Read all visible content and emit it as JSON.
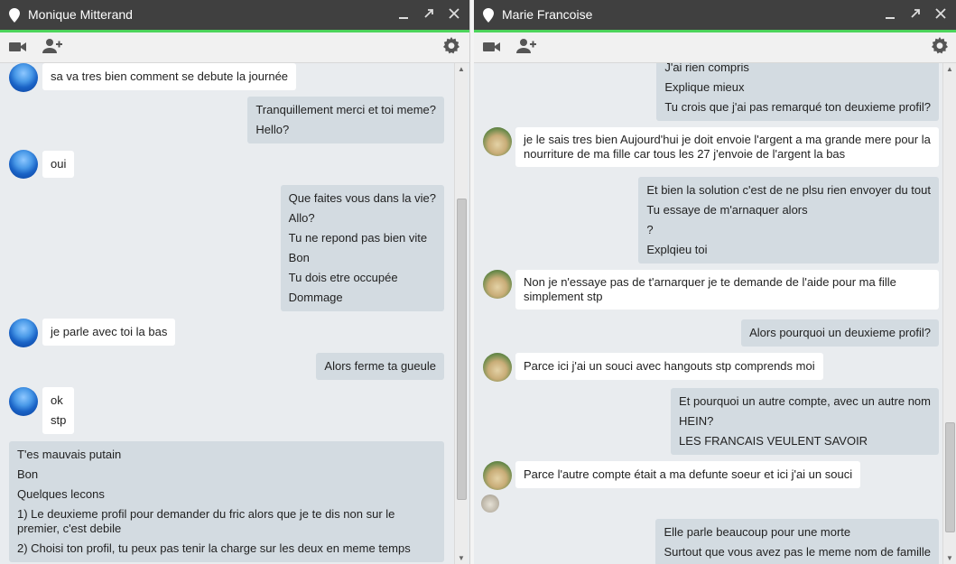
{
  "window_left": {
    "title": "Monique Mitterand",
    "messages": [
      {
        "side": "in",
        "lines": [
          "sa va tres bien comment se debute la journée"
        ]
      },
      {
        "side": "out",
        "lines": [
          "Tranquillement merci et toi meme?",
          "Hello?"
        ]
      },
      {
        "side": "in",
        "lines": [
          "oui"
        ]
      },
      {
        "side": "out",
        "lines": [
          "Que faites vous dans la vie?",
          "Allo?",
          "Tu ne repond pas bien vite",
          "Bon",
          "Tu dois etre occupée",
          "Dommage"
        ]
      },
      {
        "side": "in",
        "lines": [
          "je parle avec toi la bas"
        ]
      },
      {
        "side": "out",
        "lines": [
          "Alors ferme ta gueule"
        ]
      },
      {
        "side": "in",
        "lines": [
          "ok",
          "stp"
        ]
      },
      {
        "side": "out",
        "lines": [
          "T'es mauvais putain",
          "Bon",
          "Quelques lecons",
          "1) Le deuxieme profil pour demander du fric alors que je te dis non sur le premier, c'est debile",
          "2) Choisi ton profil, tu peux pas tenir la charge sur les deux en meme temps"
        ]
      }
    ]
  },
  "window_right": {
    "title": "Marie Francoise",
    "messages": [
      {
        "side": "out",
        "lines": [
          "J'ai rien compris",
          "Explique mieux",
          "Tu crois que j'ai pas remarqué ton deuxieme profil?"
        ]
      },
      {
        "side": "in",
        "lines": [
          "je le sais tres bien Aujourd'hui je doit envoie l'argent a ma grande mere pour la nourriture de ma fille car tous les 27 j'envoie de l'argent la bas"
        ]
      },
      {
        "side": "out",
        "lines": [
          "Et bien la solution c'est de ne plsu rien envoyer du tout",
          "Tu essaye de m'arnaquer alors",
          "?",
          "Explqieu toi"
        ]
      },
      {
        "side": "in",
        "lines": [
          "Non je n'essaye pas de t'arnarquer je te demande de l'aide pour ma fille simplement stp"
        ]
      },
      {
        "side": "out",
        "lines": [
          "Alors pourquoi un deuxieme profil?"
        ]
      },
      {
        "side": "in",
        "lines": [
          "Parce ici j'ai un souci avec hangouts stp comprends moi"
        ]
      },
      {
        "side": "out",
        "lines": [
          "Et pourquoi un autre compte, avec un autre nom",
          "HEIN?",
          "LES FRANCAIS VEULENT SAVOIR"
        ]
      },
      {
        "side": "in",
        "lines": [
          "Parce l'autre compte était a ma defunte soeur et ici j'ai un souci"
        ]
      },
      {
        "side": "out",
        "lines": [
          "Elle parle beaucoup pour une morte",
          "Surtout que vous avez pas le meme nom de famille"
        ]
      }
    ]
  },
  "icons": {
    "location": "location-pin-icon",
    "minimize": "minimize-icon",
    "popout": "popout-icon",
    "close": "close-icon",
    "video": "video-call-icon",
    "add_person": "add-person-icon",
    "settings": "gear-icon"
  },
  "colors": {
    "titlebar": "#404040",
    "accent": "#4cd45b",
    "incoming_bubble": "#ffffff",
    "outgoing_bubble": "#d3dbe1",
    "background": "#e9ecef"
  }
}
